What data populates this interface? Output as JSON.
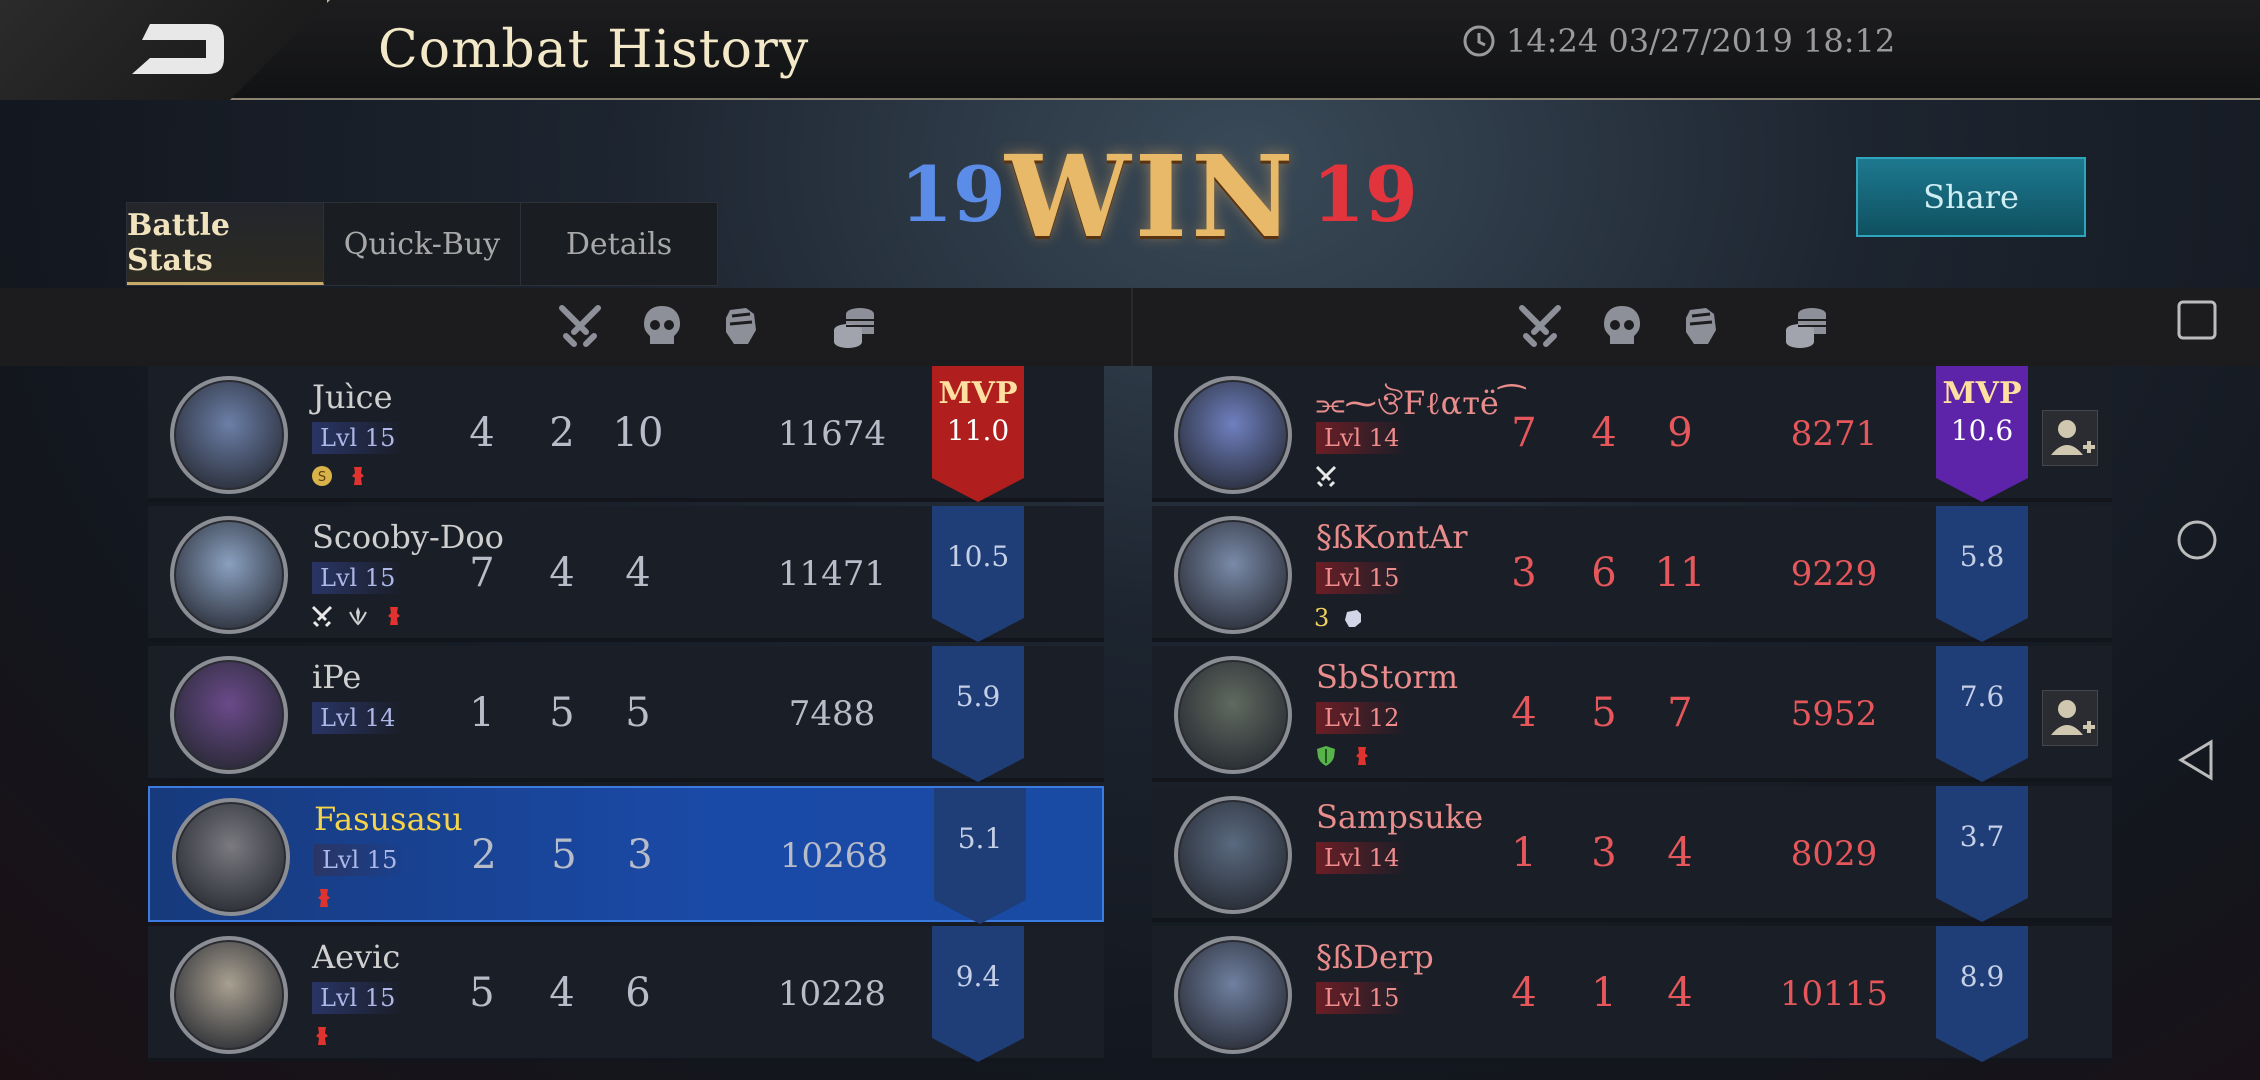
{
  "header": {
    "title": "Combat History",
    "timestamp": "14:24 03/27/2019 18:12"
  },
  "result": {
    "label": "WIN",
    "score_left": "19",
    "score_right": "19"
  },
  "share_label": "Share",
  "tabs": [
    {
      "label": "Battle Stats",
      "active": true
    },
    {
      "label": "Quick-Buy",
      "active": false
    },
    {
      "label": "Details",
      "active": false
    }
  ],
  "stat_icons": [
    "crossed-swords-icon",
    "skull-icon",
    "fist-icon",
    "coins-icon"
  ],
  "colors": {
    "blue_team": "#5b8de8",
    "red_team": "#e2343d",
    "mvp_red": "#b01e1e",
    "mvp_purple": "#5d23a8",
    "highlight": "#1a4aa8"
  },
  "team_left": [
    {
      "name": "Juìce",
      "level": "Lvl 15",
      "kills": "4",
      "deaths": "2",
      "assists": "10",
      "gold": "11674",
      "rating": "11.0",
      "mvp": true,
      "mvp_label": "MVP",
      "badges": [
        "coin-icon",
        "red-tower-icon"
      ]
    },
    {
      "name": "Scooby-Doo",
      "level": "Lvl 15",
      "kills": "7",
      "deaths": "4",
      "assists": "4",
      "gold": "11471",
      "rating": "10.5",
      "mvp": false,
      "badges": [
        "crossed-swords-icon",
        "wreath-icon",
        "red-tower-icon"
      ]
    },
    {
      "name": "iPe",
      "level": "Lvl 14",
      "kills": "1",
      "deaths": "5",
      "assists": "5",
      "gold": "7488",
      "rating": "5.9",
      "mvp": false,
      "badges": []
    },
    {
      "name": "Fasusasu",
      "level": "Lvl 15",
      "kills": "2",
      "deaths": "5",
      "assists": "3",
      "gold": "10268",
      "rating": "5.1",
      "mvp": false,
      "highlight": true,
      "badges": [
        "red-tower-icon"
      ]
    },
    {
      "name": "Aevic",
      "level": "Lvl 15",
      "kills": "5",
      "deaths": "4",
      "assists": "6",
      "gold": "10228",
      "rating": "9.4",
      "mvp": false,
      "badges": [
        "red-tower-icon"
      ]
    }
  ],
  "team_right": [
    {
      "name": "⫘⁓ঔFℓαтё⁀",
      "level": "Lvl 14",
      "kills": "7",
      "deaths": "4",
      "assists": "9",
      "gold": "8271",
      "rating": "10.6",
      "mvp": true,
      "mvp_label": "MVP",
      "add_friend": true,
      "badges": [
        "crossed-swords-icon"
      ]
    },
    {
      "name": "§ßKontAr",
      "level": "Lvl 15",
      "kills": "3",
      "deaths": "6",
      "assists": "11",
      "gold": "9229",
      "rating": "5.8",
      "mvp": false,
      "add_friend": false,
      "badge_text": "3",
      "badges": [
        "fist-icon"
      ]
    },
    {
      "name": "SbStorm",
      "level": "Lvl 12",
      "kills": "4",
      "deaths": "5",
      "assists": "7",
      "gold": "5952",
      "rating": "7.6",
      "mvp": false,
      "add_friend": true,
      "badges": [
        "shield-icon",
        "red-tower-icon"
      ]
    },
    {
      "name": "Sampsuke",
      "level": "Lvl 14",
      "kills": "1",
      "deaths": "3",
      "assists": "4",
      "gold": "8029",
      "rating": "3.7",
      "mvp": false,
      "add_friend": false,
      "badges": []
    },
    {
      "name": "§ßDerp",
      "level": "Lvl 15",
      "kills": "4",
      "deaths": "1",
      "assists": "4",
      "gold": "10115",
      "rating": "8.9",
      "mvp": false,
      "add_friend": false,
      "badges": []
    }
  ]
}
